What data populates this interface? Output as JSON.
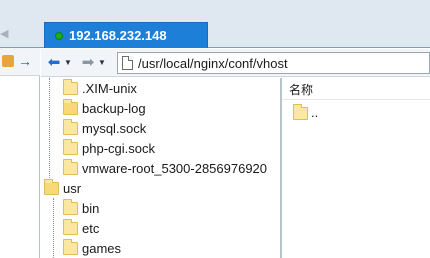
{
  "tab": {
    "title": "192.168.232.148",
    "status_color": "#18b218"
  },
  "colors": {
    "tab_bg": "#1e7fd8",
    "folder": "#fbe7a1"
  },
  "toolbar": {
    "back_icon": "back-arrow-icon",
    "forward_icon": "forward-arrow-icon",
    "path": "/usr/local/nginx/conf/vhost"
  },
  "tree": {
    "items": [
      {
        "label": ".XIM-unix"
      },
      {
        "label": "backup-log"
      },
      {
        "label": "mysql.sock"
      },
      {
        "label": "php-cgi.sock"
      },
      {
        "label": "vmware-root_5300-2856976920"
      },
      {
        "label": "usr"
      },
      {
        "label": "bin"
      },
      {
        "label": "etc"
      },
      {
        "label": "games"
      }
    ]
  },
  "file_list": {
    "column_name": "名称",
    "rows": [
      {
        "label": ".."
      }
    ]
  }
}
